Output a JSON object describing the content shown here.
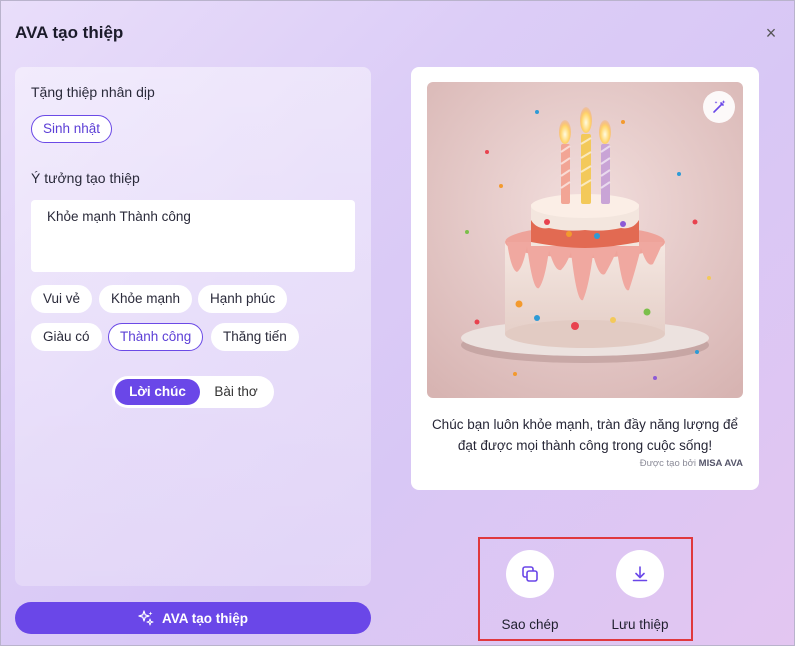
{
  "dialog": {
    "title": "AVA tạo thiệp",
    "close_symbol": "×"
  },
  "occasion": {
    "label": "Tặng thiệp nhân dịp",
    "selected": "Sinh nhật"
  },
  "idea": {
    "label": "Ý tưởng tạo thiệp",
    "value": "Khỏe mạnh Thành công"
  },
  "keywords": [
    {
      "label": "Vui vẻ",
      "selected": false
    },
    {
      "label": "Khỏe mạnh",
      "selected": false
    },
    {
      "label": "Hạnh phúc",
      "selected": false
    },
    {
      "label": "Giàu có",
      "selected": false
    },
    {
      "label": "Thành công",
      "selected": true
    },
    {
      "label": "Thăng tiến",
      "selected": false
    }
  ],
  "mode_toggle": {
    "options": [
      "Lời chúc",
      "Bài thơ"
    ],
    "active": "Lời chúc"
  },
  "generate_button": {
    "label": "AVA tạo thiệp",
    "icon": "sparkle-icon"
  },
  "card": {
    "image": "birthday-cake-with-candles",
    "message_line1": "Chúc bạn luôn khỏe mạnh, tràn đầy năng lượng để",
    "message_line2": "đạt được mọi thành công trong cuộc sống!",
    "credit_prefix": "Được tạo bởi",
    "credit_brand": "MISA AVA",
    "edit_icon": "magic-wand-icon"
  },
  "actions": {
    "copy_label": "Sao chép",
    "copy_icon": "copy-icon",
    "save_label": "Lưu thiệp",
    "save_icon": "download-icon"
  },
  "colors": {
    "accent": "#6a47e8",
    "highlight_border": "#e0383d"
  }
}
